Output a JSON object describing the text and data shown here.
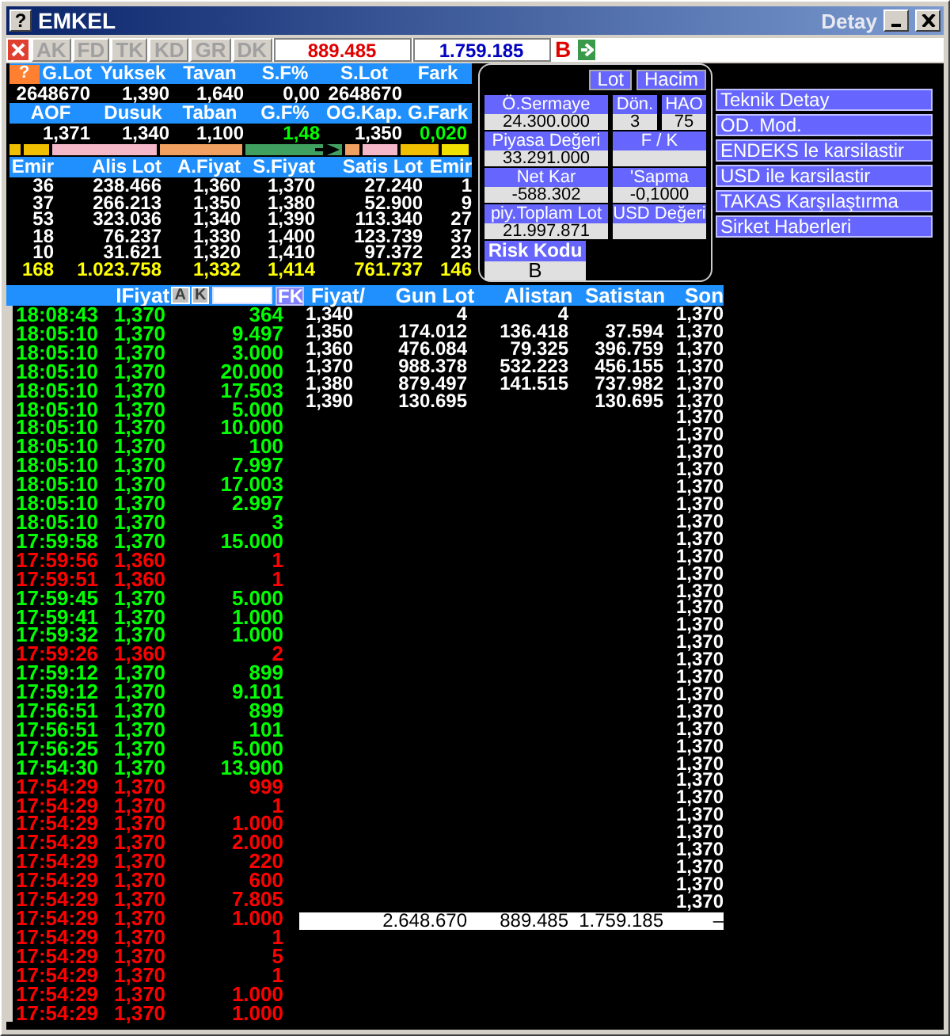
{
  "window": {
    "help_icon": "?",
    "title": "EMKEL",
    "subtitle": "Detay"
  },
  "summary_help": "?",
  "toolbar": {
    "tabs": [
      "AK",
      "FD",
      "TK",
      "KD",
      "GR",
      "DK"
    ],
    "sell_total": "889.485",
    "buy_total": "1.759.185",
    "flag": "B"
  },
  "summary": [
    {
      "kind": "header",
      "cells": [
        {
          "text": "G.Lot"
        },
        {
          "text": "Yuksek"
        },
        {
          "text": "Tavan"
        },
        {
          "text": "S.F%"
        },
        {
          "text": "S.Lot"
        },
        {
          "text": "Fark"
        }
      ]
    },
    {
      "kind": "values",
      "cells": [
        {
          "text": "2648670"
        },
        {
          "text": "1,390"
        },
        {
          "text": "1,640"
        },
        {
          "text": "0,00"
        },
        {
          "text": "2648670"
        }
      ]
    },
    {
      "kind": "header",
      "cells": [
        {
          "text": "AOF"
        },
        {
          "text": "Dusuk"
        },
        {
          "text": "Taban"
        },
        {
          "text": "G.F%"
        },
        {
          "text": "OG.Kap."
        },
        {
          "text": "G.Fark"
        }
      ]
    },
    {
      "kind": "values",
      "cells": [
        {
          "text": "1,371"
        },
        {
          "text": "1,340"
        },
        {
          "text": "1,100"
        },
        {
          "text": "1,48",
          "color": "#00ff00"
        },
        {
          "text": "1,350"
        },
        {
          "text": "0,020",
          "color": "#00ff00"
        }
      ]
    }
  ],
  "order_book": {
    "columns": [
      "Emir",
      "Alis Lot",
      "A.Fiyat",
      "S.Fiyat",
      "Satis Lot",
      "Emir"
    ],
    "rows": [
      [
        "36",
        "238.466",
        "1,360",
        "1,370",
        "27.240",
        "1"
      ],
      [
        "37",
        "266.213",
        "1,350",
        "1,380",
        "52.900",
        "9"
      ],
      [
        "53",
        "323.036",
        "1,340",
        "1,390",
        "113.340",
        "27"
      ],
      [
        "18",
        "76.237",
        "1,330",
        "1,400",
        "123.739",
        "37"
      ],
      [
        "10",
        "31.621",
        "1,320",
        "1,410",
        "97.372",
        "23"
      ]
    ],
    "totals": [
      "168",
      "1.023.758",
      "1,332",
      "1,414",
      "761.737",
      "146"
    ]
  },
  "detail": {
    "toggles": [
      "Lot",
      "Hacim"
    ],
    "rows": [
      [
        {
          "label": "Ö.Sermaye",
          "value": "24.300.000"
        },
        {
          "label": "Dön.",
          "value": "3"
        },
        {
          "label": "HAO",
          "value": "75"
        }
      ],
      [
        {
          "label": "Piyasa Değeri",
          "value": "33.291.000"
        },
        {
          "label": "F / K"
        }
      ],
      [
        {
          "label": "Net Kar",
          "value": "-588.302"
        },
        {
          "label": "'Sapma",
          "value": "-0,1000"
        }
      ],
      [
        {
          "label": "piy.Toplam Lot",
          "value": "21.997.871"
        },
        {
          "label": "USD Değeri"
        }
      ]
    ],
    "risk": {
      "label": "Risk Kodu",
      "value": "B"
    }
  },
  "links": [
    "Teknik Detay",
    "OD. Mod.",
    "ENDEKS le karsilastir",
    "USD ile karsilastir",
    "TAKAS Karşılaştırma",
    "Sirket Haberleri"
  ],
  "trades": {
    "header": "IFiyat",
    "buttons": [
      "A",
      "K"
    ],
    "filter_button": "FK",
    "rows": [
      {
        "time": "18:08:43",
        "price": "1,370",
        "lot": "364",
        "kind": "up"
      },
      {
        "time": "18:05:10",
        "price": "1,370",
        "lot": "9.497",
        "kind": "up"
      },
      {
        "time": "18:05:10",
        "price": "1,370",
        "lot": "3.000",
        "kind": "up"
      },
      {
        "time": "18:05:10",
        "price": "1,370",
        "lot": "20.000",
        "kind": "up"
      },
      {
        "time": "18:05:10",
        "price": "1,370",
        "lot": "17.503",
        "kind": "up"
      },
      {
        "time": "18:05:10",
        "price": "1,370",
        "lot": "5.000",
        "kind": "up"
      },
      {
        "time": "18:05:10",
        "price": "1,370",
        "lot": "10.000",
        "kind": "up"
      },
      {
        "time": "18:05:10",
        "price": "1,370",
        "lot": "100",
        "kind": "up"
      },
      {
        "time": "18:05:10",
        "price": "1,370",
        "lot": "7.997",
        "kind": "up"
      },
      {
        "time": "18:05:10",
        "price": "1,370",
        "lot": "17.003",
        "kind": "up"
      },
      {
        "time": "18:05:10",
        "price": "1,370",
        "lot": "2.997",
        "kind": "up"
      },
      {
        "time": "18:05:10",
        "price": "1,370",
        "lot": "3",
        "kind": "up"
      },
      {
        "time": "17:59:58",
        "price": "1,370",
        "lot": "15.000",
        "kind": "up"
      },
      {
        "time": "17:59:56",
        "price": "1,360",
        "lot": "1",
        "kind": "down"
      },
      {
        "time": "17:59:51",
        "price": "1,360",
        "lot": "1",
        "kind": "down"
      },
      {
        "time": "17:59:45",
        "price": "1,370",
        "lot": "5.000",
        "kind": "up"
      },
      {
        "time": "17:59:41",
        "price": "1,370",
        "lot": "1.000",
        "kind": "up"
      },
      {
        "time": "17:59:32",
        "price": "1,370",
        "lot": "1.000",
        "kind": "up"
      },
      {
        "time": "17:59:26",
        "price": "1,360",
        "lot": "2",
        "kind": "down"
      },
      {
        "time": "17:59:12",
        "price": "1,370",
        "lot": "899",
        "kind": "up"
      },
      {
        "time": "17:59:12",
        "price": "1,370",
        "lot": "9.101",
        "kind": "up"
      },
      {
        "time": "17:56:51",
        "price": "1,370",
        "lot": "899",
        "kind": "up"
      },
      {
        "time": "17:56:51",
        "price": "1,370",
        "lot": "101",
        "kind": "up"
      },
      {
        "time": "17:56:25",
        "price": "1,370",
        "lot": "5.000",
        "kind": "up"
      },
      {
        "time": "17:54:30",
        "price": "1,370",
        "lot": "13.900",
        "kind": "up"
      },
      {
        "time": "17:54:29",
        "price": "1,370",
        "lot": "999",
        "kind": "down"
      },
      {
        "time": "17:54:29",
        "price": "1,370",
        "lot": "1",
        "kind": "down"
      },
      {
        "time": "17:54:29",
        "price": "1,370",
        "lot": "1.000",
        "kind": "down"
      },
      {
        "time": "17:54:29",
        "price": "1,370",
        "lot": "2.000",
        "kind": "down"
      },
      {
        "time": "17:54:29",
        "price": "1,370",
        "lot": "220",
        "kind": "down"
      },
      {
        "time": "17:54:29",
        "price": "1,370",
        "lot": "600",
        "kind": "down"
      },
      {
        "time": "17:54:29",
        "price": "1,370",
        "lot": "7.805",
        "kind": "down"
      },
      {
        "time": "17:54:29",
        "price": "1,370",
        "lot": "1.000",
        "kind": "down"
      },
      {
        "time": "17:54:29",
        "price": "1,370",
        "lot": "1",
        "kind": "down"
      },
      {
        "time": "17:54:29",
        "price": "1,370",
        "lot": "5",
        "kind": "down"
      },
      {
        "time": "17:54:29",
        "price": "1,370",
        "lot": "1",
        "kind": "down"
      },
      {
        "time": "17:54:29",
        "price": "1,370",
        "lot": "1.000",
        "kind": "down"
      },
      {
        "time": "17:54:29",
        "price": "1,370",
        "lot": "1.000",
        "kind": "down"
      }
    ]
  },
  "price_table": {
    "columns": [
      "Fiyat/",
      "Gun Lot",
      "Alistan",
      "Satistan",
      "Son"
    ],
    "rows": [
      {
        "fiyat": "1,340",
        "gun_lot": "4",
        "alistan": "4"
      },
      {
        "fiyat": "1,350",
        "gun_lot": "174.012",
        "alistan": "136.418",
        "satistan": "37.594"
      },
      {
        "fiyat": "1,360",
        "gun_lot": "476.084",
        "alistan": "79.325",
        "satistan": "396.759"
      },
      {
        "fiyat": "1,370",
        "gun_lot": "988.378",
        "alistan": "532.223",
        "satistan": "456.155"
      },
      {
        "fiyat": "1,380",
        "gun_lot": "879.497",
        "alistan": "141.515",
        "satistan": "737.982"
      },
      {
        "fiyat": "1,390",
        "gun_lot": "130.695",
        "satistan": "130.695"
      }
    ],
    "son": [
      "1,370",
      "1,370",
      "1,370",
      "1,370",
      "1,370",
      "1,370",
      "1,370",
      "1,370",
      "1,370",
      "1,370",
      "1,370",
      "1,370",
      "1,370",
      "1,370",
      "1,370",
      "1,370",
      "1,370",
      "1,370",
      "1,370",
      "1,370",
      "1,370",
      "1,370",
      "1,370",
      "1,370",
      "1,370",
      "1,370",
      "1,370",
      "1,370",
      "1,370",
      "1,370",
      "1,370",
      "1,370",
      "1,370",
      "1,370",
      "1,370"
    ],
    "totals": {
      "gun_lot": "2.648.670",
      "alistan": "889.485",
      "satistan": "1.759.185",
      "son": "–"
    }
  }
}
